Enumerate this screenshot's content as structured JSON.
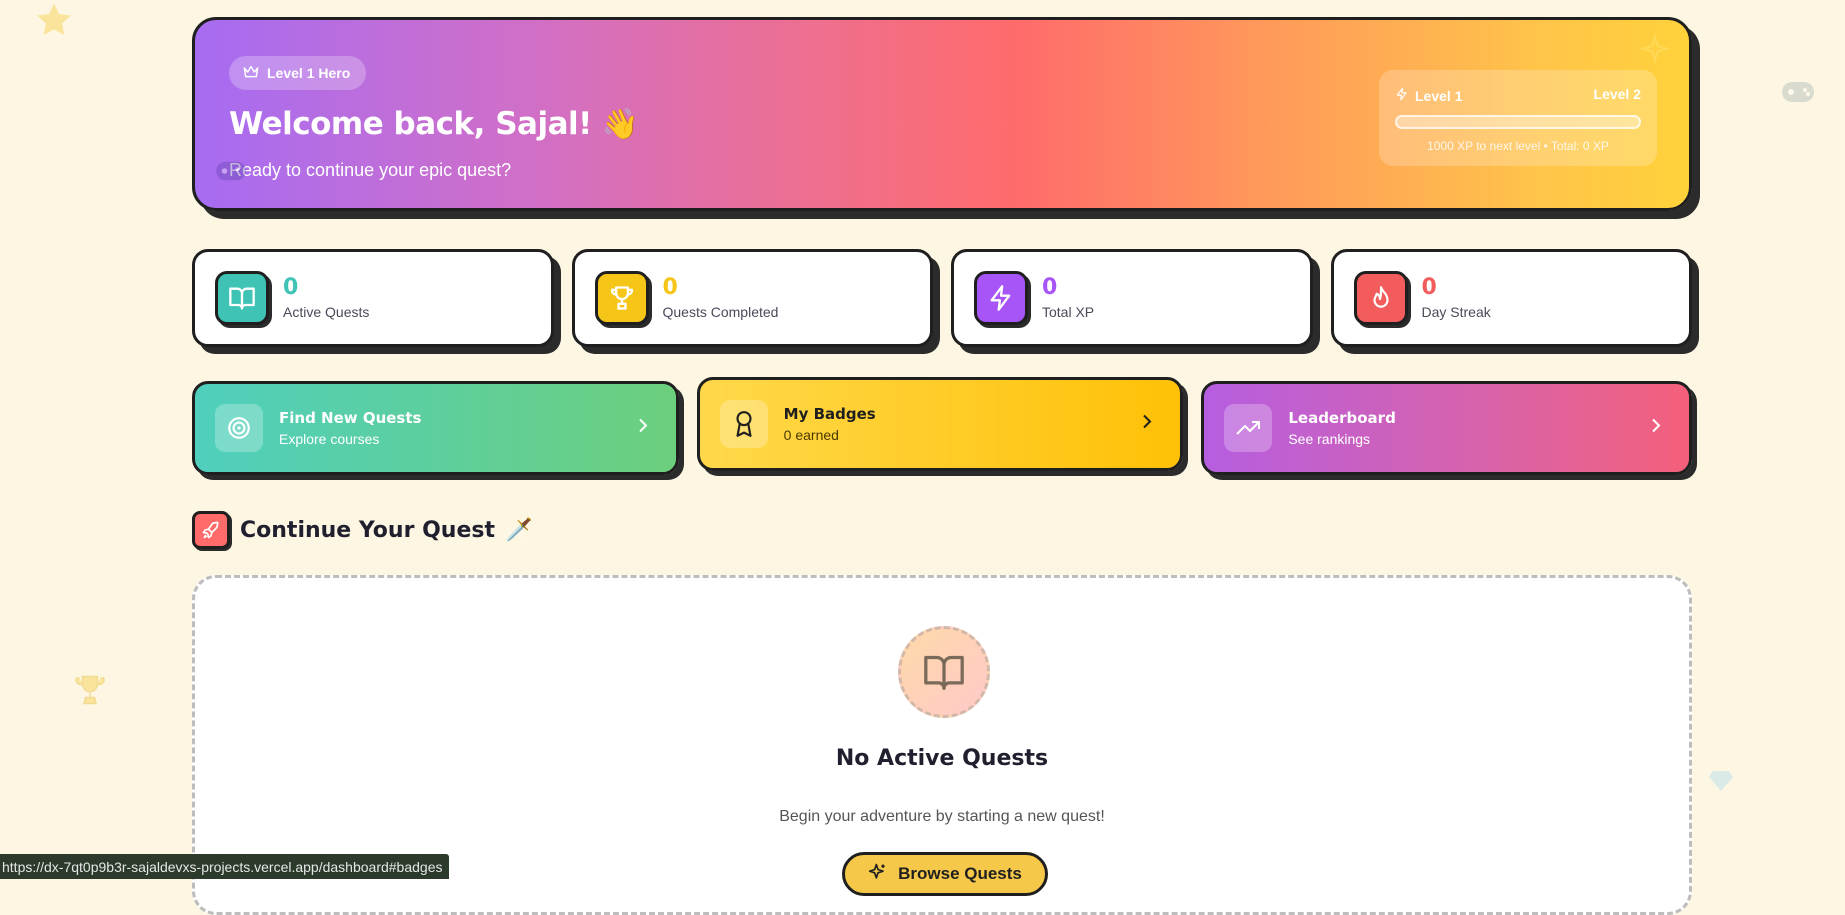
{
  "hero": {
    "badge": "Level 1 Hero",
    "title": "Welcome back, Sajal!",
    "wave": "👋",
    "subtitle": "Ready to continue your epic quest?",
    "xp": {
      "current_level": "Level 1",
      "next_level": "Level 2",
      "progress": 0,
      "note": "1000 XP to next level • Total: 0 XP"
    }
  },
  "stats": [
    {
      "value": "0",
      "label": "Active Quests",
      "color": "#3ec3b5"
    },
    {
      "value": "0",
      "label": "Quests Completed",
      "color": "#f5c518"
    },
    {
      "value": "0",
      "label": "Total XP",
      "color": "#a855f7"
    },
    {
      "value": "0",
      "label": "Day Streak",
      "color": "#f25c5c"
    }
  ],
  "actions": [
    {
      "title": "Find New Quests",
      "subtitle": "Explore courses"
    },
    {
      "title": "My Badges",
      "subtitle": "0 earned"
    },
    {
      "title": "Leaderboard",
      "subtitle": "See rankings"
    }
  ],
  "section": {
    "title": "Continue Your Quest",
    "emoji": "🗡️"
  },
  "empty": {
    "title": "No Active Quests",
    "subtitle": "Begin your adventure by starting a new quest!",
    "button": "Browse Quests"
  },
  "status_url": "https://dx-7qt0p9b3r-sajaldevxs-projects.vercel.app/dashboard#badges",
  "colors": {
    "background": "#fdf6e3",
    "teal": "#3ec3b5",
    "yellow": "#f5c518",
    "purple": "#a855f7",
    "red": "#f25c5c"
  }
}
